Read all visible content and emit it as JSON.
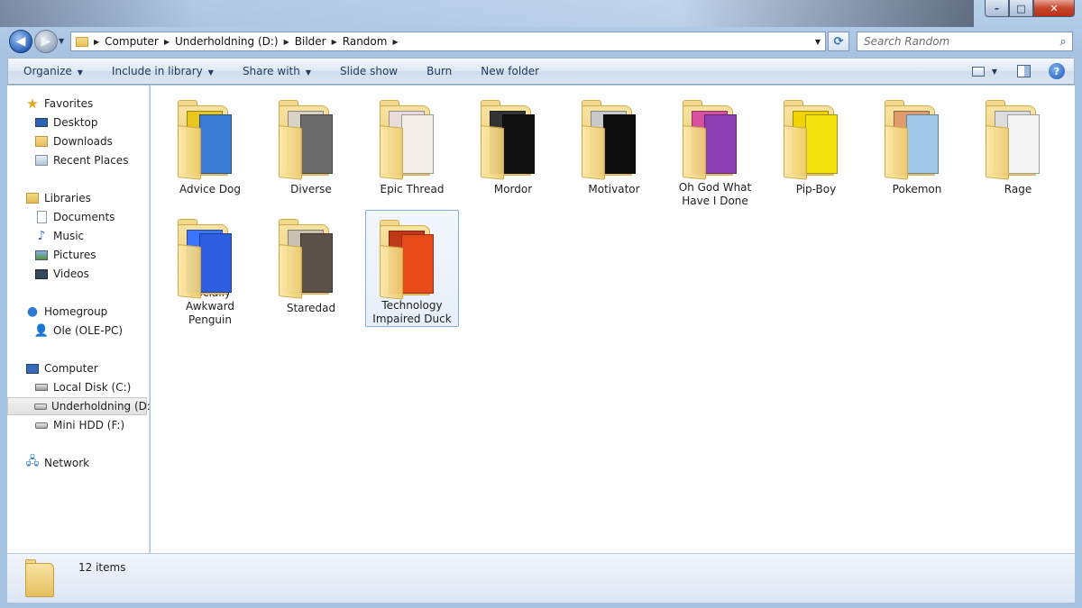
{
  "window": {
    "caption_buttons": {
      "minimize": "–",
      "maximize": "□",
      "close": "✕"
    }
  },
  "address": {
    "crumbs": [
      "Computer",
      "Underholdning (D:)",
      "Bilder",
      "Random"
    ],
    "search_placeholder": "Search Random"
  },
  "toolbar": {
    "organize": "Organize",
    "include_in_library": "Include in library",
    "share_with": "Share with",
    "slide_show": "Slide show",
    "burn": "Burn",
    "new_folder": "New folder"
  },
  "navpane": {
    "favorites": "Favorites",
    "desktop": "Desktop",
    "downloads": "Downloads",
    "recent_places": "Recent Places",
    "libraries": "Libraries",
    "documents": "Documents",
    "music": "Music",
    "pictures": "Pictures",
    "videos": "Videos",
    "homegroup": "Homegroup",
    "ole_pc": "Ole (OLE-PC)",
    "computer": "Computer",
    "local_disk": "Local Disk (C:)",
    "underholdning": "Underholdning (D:)",
    "mini_hdd": "Mini HDD (F:)",
    "network": "Network"
  },
  "folders": [
    {
      "label": "Advice Dog",
      "colors": [
        "#3a7bd5",
        "#e8c81e"
      ]
    },
    {
      "label": "Diverse",
      "colors": [
        "#6b6b6b",
        "#d8d2c4"
      ]
    },
    {
      "label": "Epic Thread",
      "colors": [
        "#f2eee6",
        "#e8dcdc"
      ]
    },
    {
      "label": "Mordor",
      "colors": [
        "#111111",
        "#333333"
      ]
    },
    {
      "label": "Motivator",
      "colors": [
        "#0d0d0d",
        "#c9c9c9"
      ]
    },
    {
      "label": "Oh God What Have I Done",
      "colors": [
        "#8a3fb3",
        "#d94fa0"
      ]
    },
    {
      "label": "Pip-Boy",
      "colors": [
        "#f4e20c",
        "#f0d300"
      ]
    },
    {
      "label": "Pokemon",
      "colors": [
        "#9fc8e8",
        "#e09b6a"
      ]
    },
    {
      "label": "Rage",
      "colors": [
        "#f4f4f4",
        "#dddddd"
      ]
    },
    {
      "label": "Socially Awkward Penguin",
      "colors": [
        "#2d5fe0",
        "#3a74ff"
      ]
    },
    {
      "label": "Staredad",
      "colors": [
        "#5b5148",
        "#c9c0b0"
      ]
    },
    {
      "label": "Technology Impaired Duck",
      "colors": [
        "#e64a19",
        "#c0391b"
      ]
    }
  ],
  "details": {
    "item_count": "12 items"
  }
}
